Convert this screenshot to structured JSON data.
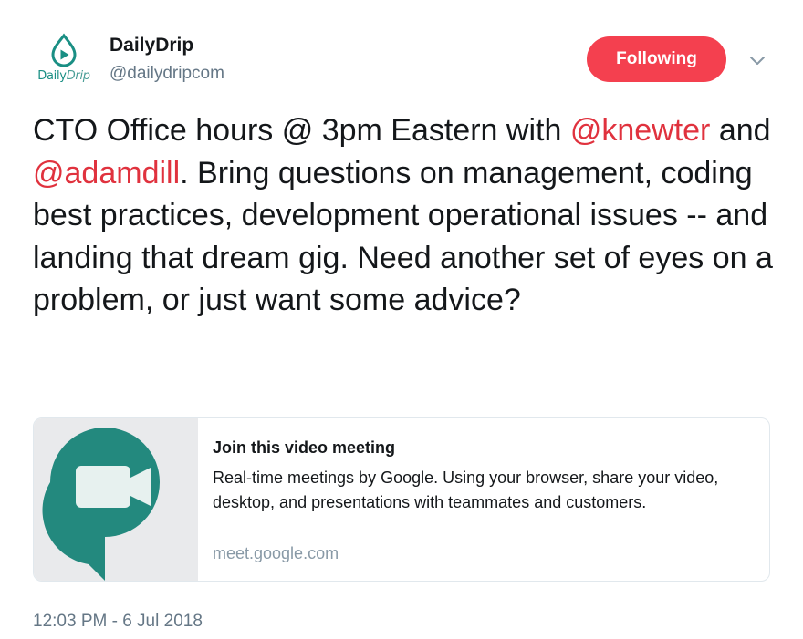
{
  "author": {
    "avatar_text_main": "Daily",
    "avatar_text_sub": "Drip",
    "display_name": "DailyDrip",
    "handle": "@dailydripcom"
  },
  "follow_button": {
    "label": "Following",
    "color": "#f4404f"
  },
  "caret_icon": "chevron-down-icon",
  "tweet": {
    "text_part1": "CTO Office hours @ 3pm Eastern with ",
    "mention1": "@knewter",
    "text_part2": " and ",
    "mention2": "@adamdill",
    "text_part3": ". Bring questions on management, coding best practices, development operational issues -- and landing that dream gig. Need another set of eyes on a problem, or just want some advice?",
    "mention_color": "#e0323e"
  },
  "card": {
    "icon": "google-meet-icon",
    "title": "Join this video meeting",
    "description": "Real-time meetings by Google. Using your browser, share your video, desktop, and presentations with teammates and customers.",
    "domain": "meet.google.com",
    "icon_color": "#23897e"
  },
  "timestamp": "12:03 PM - 6 Jul 2018"
}
